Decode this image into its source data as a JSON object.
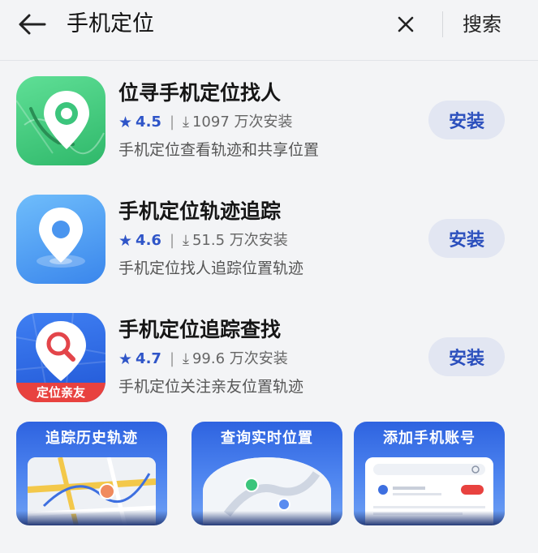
{
  "header": {
    "query": "手机定位",
    "search_label": "搜索"
  },
  "apps": [
    {
      "name": "位寻手机定位找人",
      "rating": "4.5",
      "downloads": "1097 万次安装",
      "description": "手机定位查看轨迹和共享位置",
      "install_label": "安装",
      "icon": "green-location-pin-icon"
    },
    {
      "name": "手机定位轨迹追踪",
      "rating": "4.6",
      "downloads": "51.5 万次安装",
      "description": "手机定位找人追踪位置轨迹",
      "install_label": "安装",
      "icon": "blue-location-pin-icon"
    },
    {
      "name": "手机定位追踪查找",
      "rating": "4.7",
      "downloads": "99.6 万次安装",
      "description": "手机定位关注亲友位置轨迹",
      "install_label": "安装",
      "icon": "search-pin-icon",
      "icon_banner": "定位亲友"
    }
  ],
  "screenshots": [
    {
      "title": "追踪历史轨迹"
    },
    {
      "title": "查询实时位置"
    },
    {
      "title": "添加手机账号"
    }
  ],
  "colors": {
    "accent": "#2f55c8",
    "install_bg": "#e2e6f2",
    "background": "#f3f4f6"
  }
}
